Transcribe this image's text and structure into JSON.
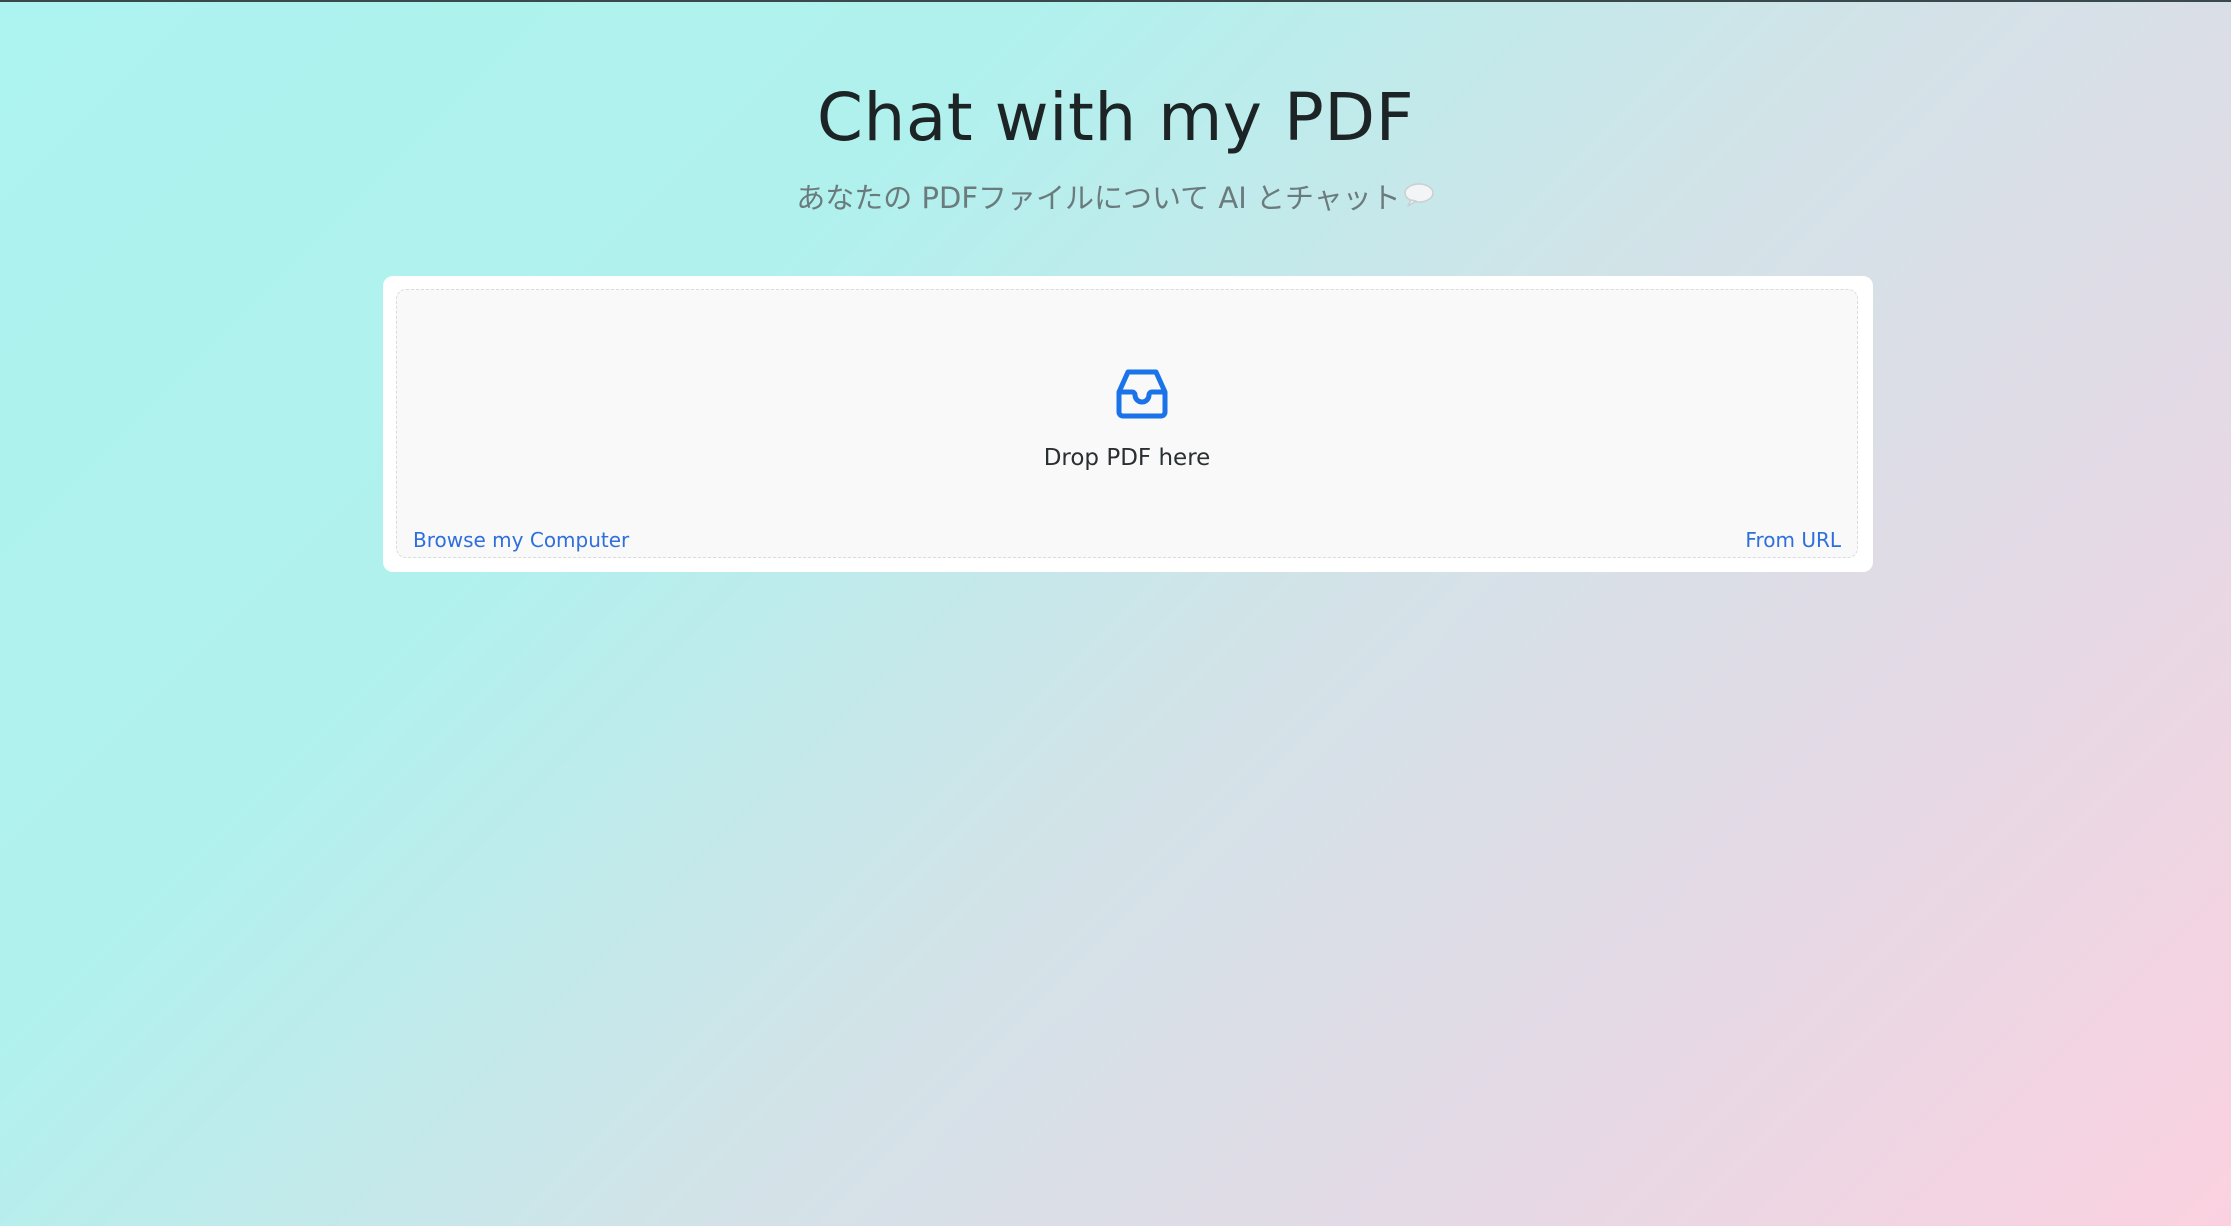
{
  "header": {
    "title": "Chat with my PDF",
    "subtitle": "あなたの PDFファイルについて AI とチャット"
  },
  "icons": {
    "subtitle_icon": "speech-bubble-icon",
    "dropzone_icon": "inbox-icon"
  },
  "dropzone": {
    "label": "Drop PDF here",
    "browse_label": "Browse my Computer",
    "url_label": "From URL"
  },
  "colors": {
    "accent": "#1a73e8",
    "link": "#2f6fdc",
    "title": "#1c2426",
    "subtitle": "#6b7b7d",
    "gradient_start": "#adf3ef",
    "gradient_end": "#fbd1e0"
  }
}
